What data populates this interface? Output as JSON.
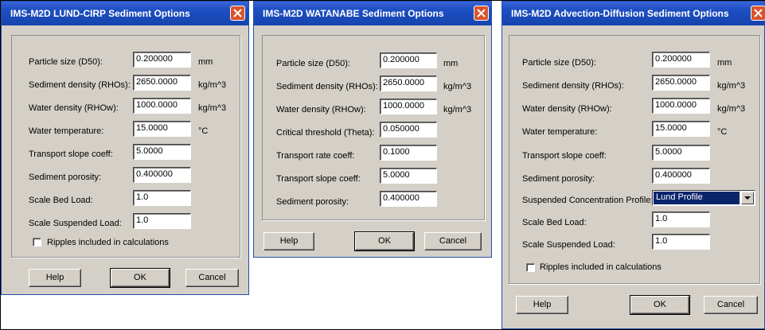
{
  "colors": {
    "titlebar": "#1d4fc2",
    "dialog_bg": "#d4d0c8",
    "close_button": "#d9542e",
    "selection": "#0a246a"
  },
  "lund": {
    "title": "IMS-M2D LUND-CIRP Sediment Options",
    "close_icon": "close-x-icon",
    "fields": {
      "particle_size": {
        "label": "Particle size (D50):",
        "value": "0.200000",
        "unit": "mm"
      },
      "sediment_density": {
        "label": "Sediment density (RHOs):",
        "value": "2650.0000",
        "unit": "kg/m^3"
      },
      "water_density": {
        "label": "Water density (RHOw):",
        "value": "1000.0000",
        "unit": "kg/m^3"
      },
      "water_temperature": {
        "label": "Water temperature:",
        "value": "15.0000",
        "unit": "°C"
      },
      "transport_slope": {
        "label": "Transport slope coeff:",
        "value": "5.0000"
      },
      "sediment_porosity": {
        "label": "Sediment porosity:",
        "value": "0.400000"
      },
      "scale_bed_load": {
        "label": "Scale Bed Load:",
        "value": "1.0"
      },
      "scale_suspended_load": {
        "label": "Scale Suspended Load:",
        "value": "1.0"
      }
    },
    "ripples_label": "Ripples included in calculations",
    "ripples_checked": false,
    "buttons": {
      "help": "Help",
      "ok": "OK",
      "cancel": "Cancel"
    }
  },
  "watanabe": {
    "title": "IMS-M2D WATANABE Sediment Options",
    "close_icon": "close-x-icon",
    "fields": {
      "particle_size": {
        "label": "Particle size (D50):",
        "value": "0.200000",
        "unit": "mm"
      },
      "sediment_density": {
        "label": "Sediment density (RHOs):",
        "value": "2650.0000",
        "unit": "kg/m^3"
      },
      "water_density": {
        "label": "Water density (RHOw):",
        "value": "1000.0000",
        "unit": "kg/m^3"
      },
      "critical_threshold": {
        "label": "Critical threshold (Theta):",
        "value": "0.050000"
      },
      "transport_rate": {
        "label": "Transport rate coeff:",
        "value": "0.1000"
      },
      "transport_slope": {
        "label": "Transport slope coeff:",
        "value": "5.0000"
      },
      "sediment_porosity": {
        "label": "Sediment porosity:",
        "value": "0.400000"
      }
    },
    "buttons": {
      "help": "Help",
      "ok": "OK",
      "cancel": "Cancel"
    }
  },
  "advection": {
    "title": "IMS-M2D Advection-Diffusion Sediment Options",
    "close_icon": "close-x-icon",
    "fields": {
      "particle_size": {
        "label": "Particle size (D50):",
        "value": "0.200000",
        "unit": "mm"
      },
      "sediment_density": {
        "label": "Sediment density (RHOs):",
        "value": "2650.0000",
        "unit": "kg/m^3"
      },
      "water_density": {
        "label": "Water density (RHOw):",
        "value": "1000.0000",
        "unit": "kg/m^3"
      },
      "water_temperature": {
        "label": "Water temperature:",
        "value": "15.0000",
        "unit": "°C"
      },
      "transport_slope": {
        "label": "Transport slope coeff:",
        "value": "5.0000"
      },
      "sediment_porosity": {
        "label": "Sediment porosity:",
        "value": "0.400000"
      },
      "suspended_profile": {
        "label": "Suspended Concentration Profile:",
        "value": "Lund Profile"
      },
      "scale_bed_load": {
        "label": "Scale Bed Load:",
        "value": "1.0"
      },
      "scale_suspended_load": {
        "label": "Scale Suspended Load:",
        "value": "1.0"
      }
    },
    "ripples_label": "Ripples included in calculations",
    "ripples_checked": false,
    "buttons": {
      "help": "Help",
      "ok": "OK",
      "cancel": "Cancel"
    }
  }
}
